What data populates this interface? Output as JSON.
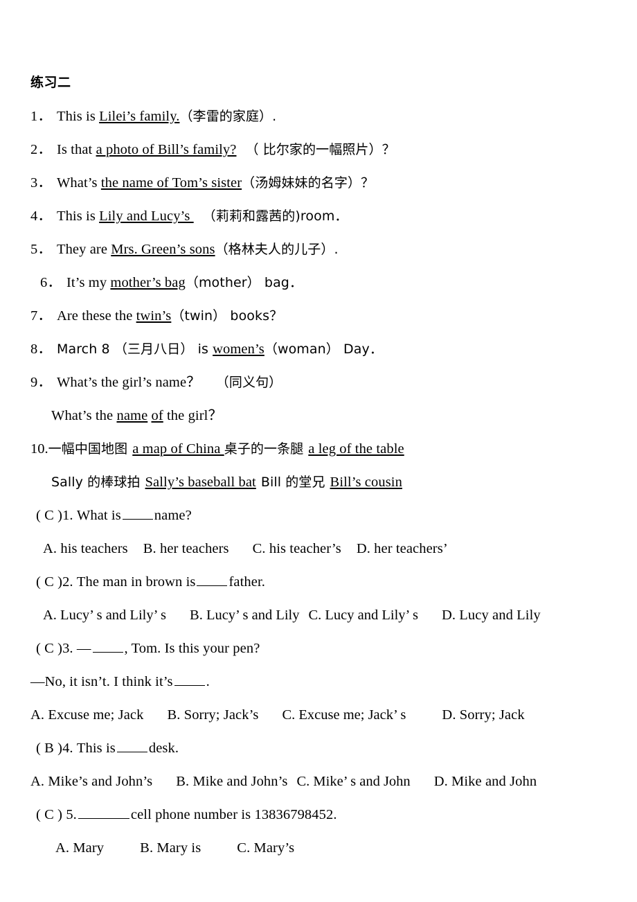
{
  "document": {
    "title": "练习二",
    "language": "zh-CN/en",
    "page_background": "#ffffff",
    "text_color": "#000000"
  },
  "fill_in_section": {
    "items": [
      {
        "number": "1．",
        "pre": "This is ",
        "answer": "Lilei’s family.",
        "post": "（李雷的家庭）."
      },
      {
        "number": "2．",
        "pre": "Is that ",
        "answer": "a photo of Bill’s family?",
        "post": "（ 比尔家的一幅照片）？"
      },
      {
        "number": "3．",
        "pre": "What’s ",
        "answer": "the name of Tom’s sister",
        "post": "（汤姆妹妹的名字）？"
      },
      {
        "number": "4．",
        "pre": "This is ",
        "answer": "Lily and Lucy’s ",
        "post": "（莉莉和露茜的)room．"
      },
      {
        "number": "5．",
        "pre": "They are ",
        "answer": "Mrs. Green’s     sons",
        "post": "（格林夫人的儿子）."
      },
      {
        "number": "6．",
        "pre": "It’s my ",
        "answer": "mother’s bag",
        "post": "（mother） bag．"
      },
      {
        "number": "7．",
        "pre": "Are these the ",
        "answer": "twin’s",
        "post": "（twin）  books？"
      },
      {
        "number": "8．",
        "pre": "March 8 （三月八日） is ",
        "answer": "women’s",
        "post": "（woman）  Day．"
      },
      {
        "number": "9．",
        "pre": "What’s the girl’s name？",
        "answer": "",
        "post": "（同义句）"
      }
    ],
    "item9_second_line": {
      "pre": "What’s the ",
      "answer1": "name",
      "mid": " ",
      "answer2": "of",
      "post": " the girl？"
    },
    "item10": {
      "number": "10.",
      "cn1": "一幅中国地图",
      "en1": "a map of China ",
      "cn2": "桌子的一条腿",
      "en2": "a leg of the table"
    },
    "item10_second_line": {
      "cn1": "Sally 的棒球拍",
      "en1": "Sally’s baseball bat",
      "cn2": "Bill 的堂兄",
      "en2": "Bill’s cousin"
    }
  },
  "multiple_choice": {
    "questions": [
      {
        "answer_mark": "( C )",
        "number": "1.",
        "stem_pre": "What is",
        "stem_post": "name?",
        "options": [
          "A. his teachers",
          "B. her teachers",
          "C. his teacher’s",
          "D. her teachers’"
        ]
      },
      {
        "answer_mark": "( C )",
        "number": "2.",
        "stem_pre": "The man in brown is",
        "stem_post": "father.",
        "options": [
          "A. Lucy’ s and Lily’ s",
          "B. Lucy’ s and Lily",
          "C. Lucy and Lily’ s",
          "D. Lucy and Lily"
        ]
      },
      {
        "answer_mark": "( C )",
        "number": "3.",
        "stem_pre": "—",
        "stem_post": ", Tom. Is this your pen?",
        "stem_line2": "—No, it isn’t. I think it’s",
        "stem_line2_post": ".",
        "options": [
          "A. Excuse me; Jack",
          "B. Sorry; Jack’s",
          "C. Excuse me; Jack’ s",
          "D. Sorry; Jack"
        ]
      },
      {
        "answer_mark": "( B )",
        "number": "4.",
        "stem_pre": "This is",
        "stem_post": "desk.",
        "options": [
          "A. Mike’s and John’s",
          "B. Mike and John’s",
          "C. Mike’ s and John",
          "D. Mike and John"
        ]
      },
      {
        "answer_mark": "( C )",
        "number": "5.",
        "stem_pre": "",
        "stem_post": "cell phone number is 13836798452.",
        "options": [
          "A. Mary",
          "B. Mary is",
          "C. Mary’s"
        ]
      }
    ]
  }
}
